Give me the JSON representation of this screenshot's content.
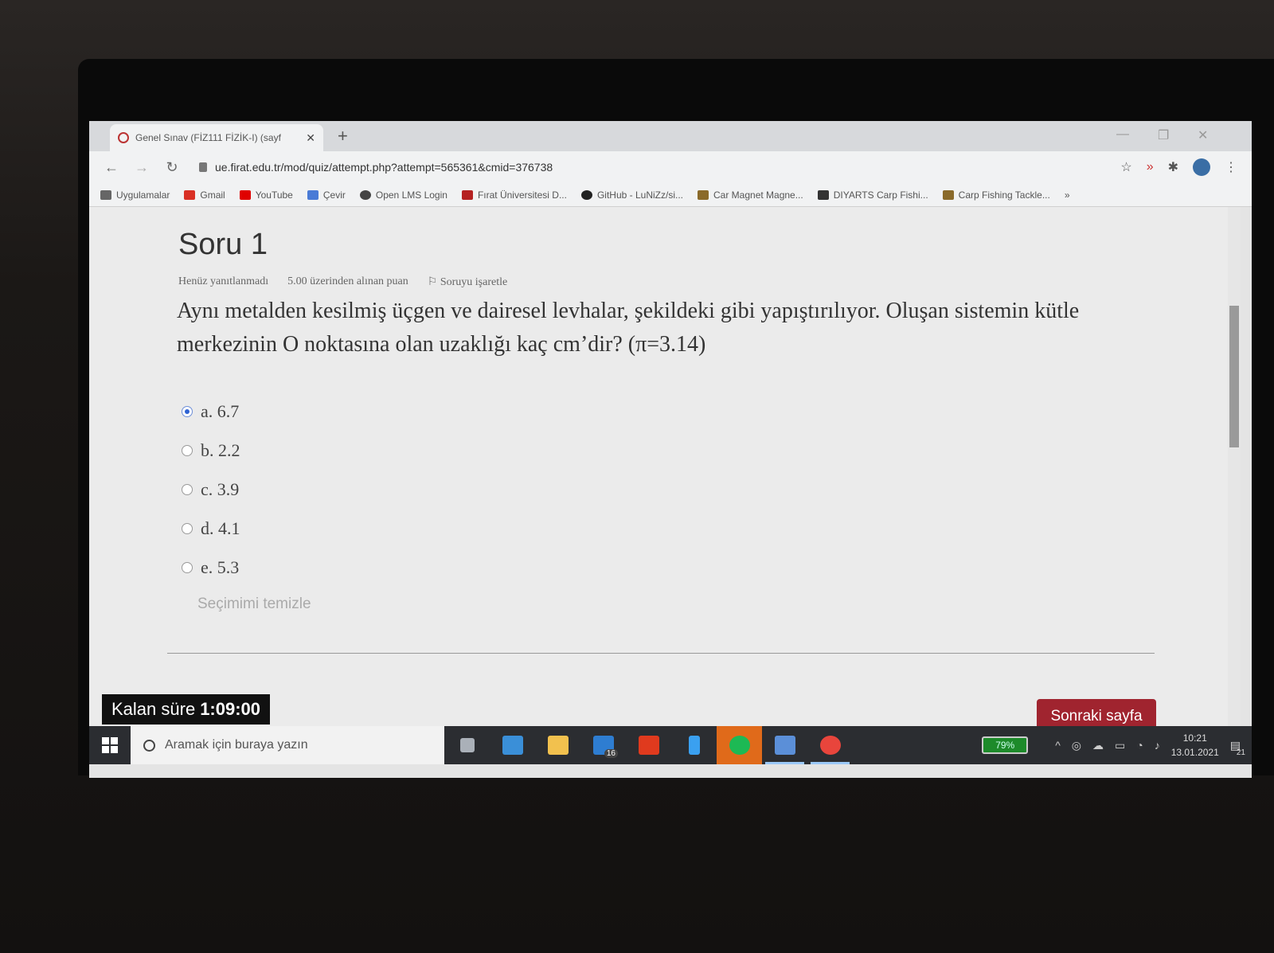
{
  "browser": {
    "tab_title": "Genel Sınav (FİZ111 FİZİK-I) (sayf",
    "url": "ue.firat.edu.tr/mod/quiz/attempt.php?attempt=565361&cmid=376738"
  },
  "bookmarks": [
    {
      "label": "Uygulamalar",
      "color": "#666666"
    },
    {
      "label": "Gmail",
      "color": "#d93025"
    },
    {
      "label": "YouTube",
      "color": "#e00000"
    },
    {
      "label": "Çevir",
      "color": "#4a7bd6"
    },
    {
      "label": "Open LMS Login",
      "color": "#444444"
    },
    {
      "label": "Fırat Üniversitesi D...",
      "color": "#b52222"
    },
    {
      "label": "GitHub - LuNiZz/si...",
      "color": "#222222"
    },
    {
      "label": "Car Magnet Magne...",
      "color": "#8a6a2a"
    },
    {
      "label": "DIYARTS Carp Fishi...",
      "color": "#333333"
    },
    {
      "label": "Carp Fishing Tackle...",
      "color": "#8a6a2a"
    }
  ],
  "question": {
    "title": "Soru 1",
    "status": "Henüz yanıtlanmadı",
    "points": "5.00 üzerinden alınan puan",
    "flag": "Soruyu işaretle",
    "text": "Aynı metalden kesilmiş üçgen ve dairesel levhalar, şekildeki gibi yapıştırılıyor. Oluşan sistemin kütle merkezinin O noktasına olan uzaklığı kaç cm’dir? (π=3.14)",
    "answers": [
      {
        "label": "a. 6.7",
        "selected": true
      },
      {
        "label": "b. 2.2",
        "selected": false
      },
      {
        "label": "c. 3.9",
        "selected": false
      },
      {
        "label": "d. 4.1",
        "selected": false
      },
      {
        "label": "e. 5.3",
        "selected": false
      }
    ],
    "clear_label": "Seçimimi temizle"
  },
  "timer": {
    "label": "Kalan süre",
    "value": "1:09:00"
  },
  "next_button": "Sonraki sayfa",
  "taskbar": {
    "search_placeholder": "Aramak için buraya yazın",
    "apps": [
      {
        "name": "task-view",
        "color": "#aab0b8",
        "badge": ""
      },
      {
        "name": "network-app",
        "color": "#3a8fd8",
        "badge": ""
      },
      {
        "name": "file-explorer",
        "color": "#f2c14e",
        "badge": ""
      },
      {
        "name": "mail",
        "color": "#2e7dd1",
        "badge": "16"
      },
      {
        "name": "office",
        "color": "#e03a1e",
        "badge": ""
      },
      {
        "name": "phone-app",
        "color": "#3aa0f0",
        "badge": ""
      },
      {
        "name": "spotify",
        "color": "#1db954",
        "badge": ""
      },
      {
        "name": "photos",
        "color": "#5b8fd8",
        "badge": ""
      },
      {
        "name": "chrome",
        "color": "#e8453c",
        "badge": ""
      }
    ],
    "battery": "79%",
    "time": "10:21",
    "date": "13.01.2021",
    "notifications": "21"
  }
}
